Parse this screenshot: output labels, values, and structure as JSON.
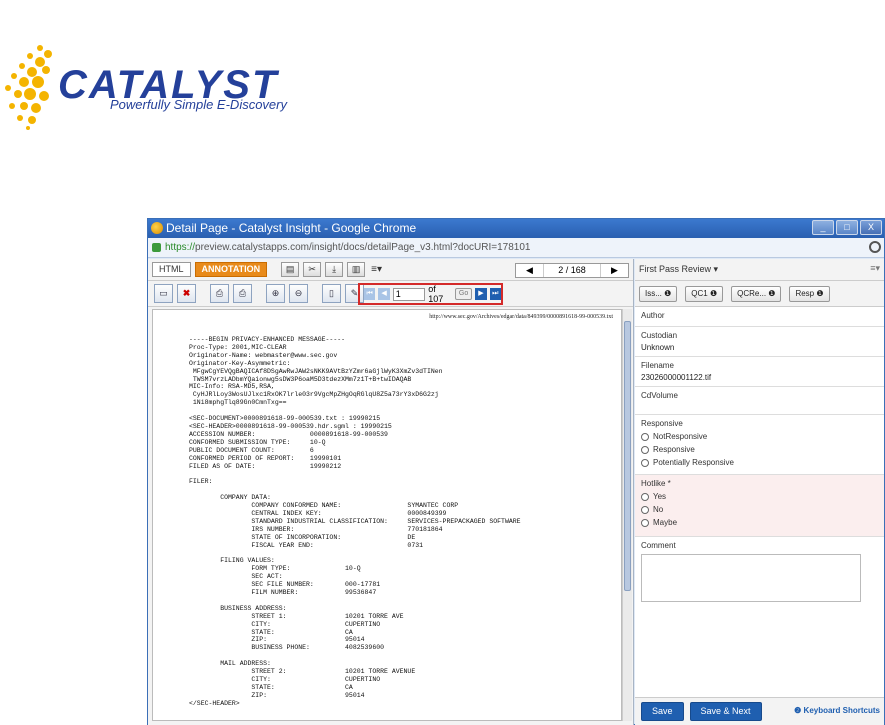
{
  "logo": {
    "word": "CATALYST",
    "tagline": "Powerfully Simple E-Discovery"
  },
  "window": {
    "title": "Detail Page - Catalyst Insight - Google Chrome",
    "controls": {
      "minimize": "_",
      "maximize": "□",
      "close": "X"
    },
    "url_scheme": "https://",
    "url_rest": "preview.catalystapps.com/insight/docs/detailPage_v3.html?docURI=178101"
  },
  "viewer": {
    "tabs": [
      {
        "label": "HTML"
      },
      {
        "label": "ANNOTATION"
      }
    ],
    "tools": [
      "folder-icon",
      "scissors-icon",
      "download-icon",
      "columns-icon"
    ],
    "doc_pager": {
      "prev": "◀",
      "text": "2 / 168",
      "next": "▶"
    },
    "page_nav": {
      "page": "1",
      "of": "of 107",
      "go": "Go"
    },
    "doc_url": "http://www.sec.gov/Archives/edgar/data/849399/0000891618-99-000539.txt",
    "doc_lines": [
      "-----BEGIN PRIVACY-ENHANCED MESSAGE-----",
      "Proc-Type: 2001,MIC-CLEAR",
      "Originator-Name: webmaster@www.sec.gov",
      "Originator-Key-Asymmetric:",
      " MFgwCgYEVQgBAQICAf8DSgAwRwJAW2sNKK9AVtBzYZmr6aGjlWyK3XmZv3dTINen",
      " TWSM7vrzLADbmYQaionwg5sDW3P6oaM5D3tdezXMm7z1T+B+twIDAQAB",
      "MIC-Info: RSA-MD5,RSA,",
      " CyHJRlLoy3WosUJlxc1RxOK7lrle03r9VgcMpZHgOqRGlqU8Z5a73rY3xD6G2zj",
      " 1Ni8mphgTlq89Gn0CmnTxg==",
      "",
      "<SEC-DOCUMENT>0000891618-99-000539.txt : 19990215",
      "<SEC-HEADER>0000891618-99-000539.hdr.sgml : 19990215",
      "ACCESSION NUMBER:              0000891618-99-000539",
      "CONFORMED SUBMISSION TYPE:     10-Q",
      "PUBLIC DOCUMENT COUNT:         6",
      "CONFORMED PERIOD OF REPORT:    19990101",
      "FILED AS OF DATE:              19990212",
      "",
      "FILER:",
      "",
      "        COMPANY DATA:",
      "                COMPANY CONFORMED NAME:                 SYMANTEC CORP",
      "                CENTRAL INDEX KEY:                      0000849399",
      "                STANDARD INDUSTRIAL CLASSIFICATION:     SERVICES-PREPACKAGED SOFTWARE",
      "                IRS NUMBER:                             770181864",
      "                STATE OF INCORPORATION:                 DE",
      "                FISCAL YEAR END:                        0731",
      "",
      "        FILING VALUES:",
      "                FORM TYPE:              10-Q",
      "                SEC ACT:",
      "                SEC FILE NUMBER:        000-17781",
      "                FILM NUMBER:            99536847",
      "",
      "        BUSINESS ADDRESS:",
      "                STREET 1:               10201 TORRE AVE",
      "                CITY:                   CUPERTINO",
      "                STATE:                  CA",
      "                ZIP:                    95014",
      "                BUSINESS PHONE:         4082539600",
      "",
      "        MAIL ADDRESS:",
      "                STREET 2:               10201 TORRE AVENUE",
      "                CITY:                   CUPERTINO",
      "                STATE:                  CA",
      "                ZIP:                    95014",
      "</SEC-HEADER>"
    ]
  },
  "review": {
    "title": "First Pass Review ▾",
    "buttons": [
      {
        "label": "Iss... ❶"
      },
      {
        "label": "QC1 ❶"
      },
      {
        "label": "QCRe... ❶"
      },
      {
        "label": "Resp ❶"
      }
    ],
    "fields": {
      "author_label": "Author",
      "custodian_label": "Custodian",
      "custodian_value": "Unknown",
      "filename_label": "Filename",
      "filename_value": "23026000001122.tif",
      "cdvolume_label": "CdVolume",
      "responsive_label": "Responsive",
      "responsive_options": [
        "NotResponsive",
        "Responsive",
        "Potentially Responsive"
      ],
      "hotlike_label": "Hotlike *",
      "hotlike_options": [
        "Yes",
        "No",
        "Maybe"
      ],
      "comment_label": "Comment"
    },
    "footer": {
      "save": "Save",
      "save_next": "Save & Next",
      "shortcuts": "❷ Keyboard Shortcuts"
    }
  }
}
